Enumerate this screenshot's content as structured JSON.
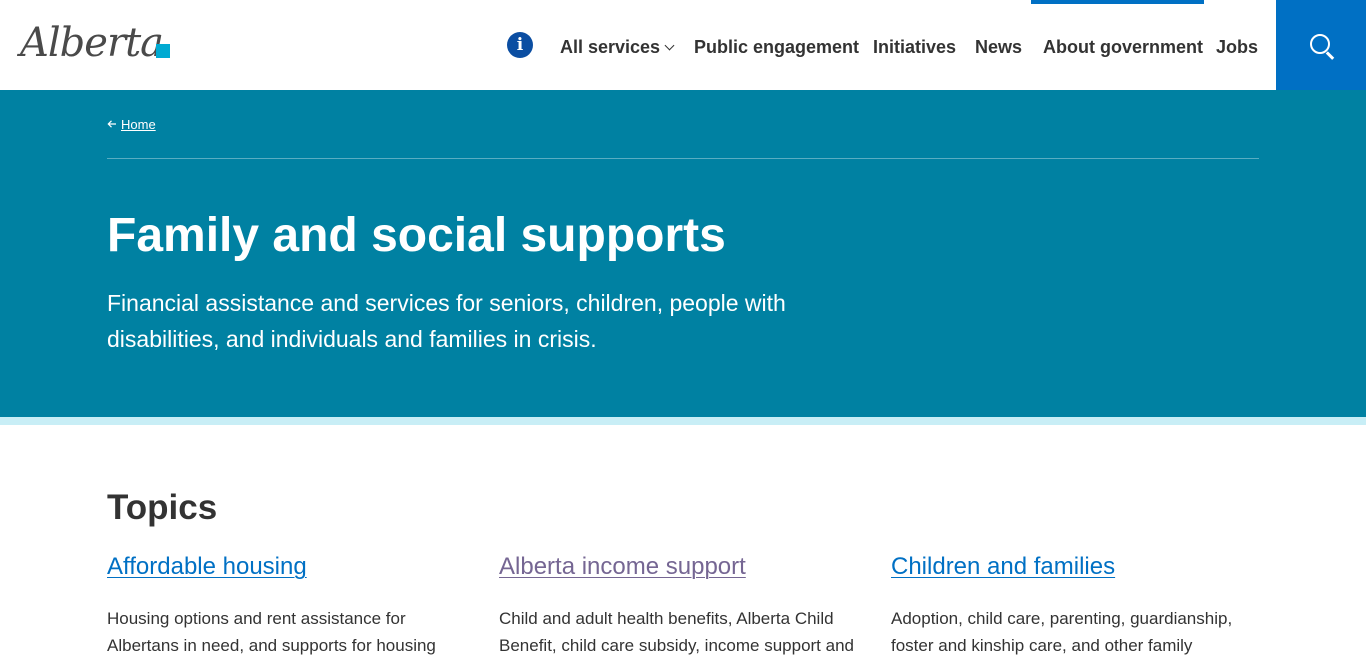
{
  "header": {
    "logo_text": "Alberta",
    "info_icon": "i",
    "nav": [
      {
        "label": "All services",
        "has_dropdown": true
      },
      {
        "label": "Public engagement"
      },
      {
        "label": "Initiatives"
      },
      {
        "label": "News"
      },
      {
        "label": "About government"
      },
      {
        "label": "Jobs"
      }
    ],
    "search_icon": "search-icon",
    "accent": "#0070c4"
  },
  "hero": {
    "breadcrumb": "Home",
    "title": "Family and social supports",
    "description": "Financial assistance and services for seniors, children, people with disabilities, and individuals and families in crisis.",
    "background": "#0081a2"
  },
  "topics": {
    "heading": "Topics",
    "items": [
      {
        "title": "Affordable housing",
        "description": "Housing options and rent assistance for Albertans in need, and supports for housing"
      },
      {
        "title": "Alberta income support",
        "description": "Child and adult health benefits, Alberta Child Benefit, child care subsidy, income support and"
      },
      {
        "title": "Children and families",
        "description": "Adoption, child care, parenting, guardianship, foster and kinship care, and other family"
      }
    ]
  }
}
